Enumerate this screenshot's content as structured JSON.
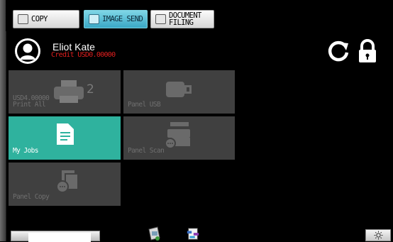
{
  "modes": {
    "copy_label": "COPY",
    "image_send_label": "IMAGE SEND",
    "document_filing_label": "DOCUMENT FILING"
  },
  "user": {
    "name": "Eliot Kate",
    "credit": "Credit USD0.00000"
  },
  "tiles": {
    "print_all": {
      "label": "Print All",
      "amount": "USD4.00000",
      "count": "2",
      "icon": "printer-icon"
    },
    "panel_usb": {
      "label": "Panel USB",
      "icon": "usb-icon"
    },
    "my_jobs": {
      "label": "My Jobs",
      "icon": "document-icon"
    },
    "panel_scan": {
      "label": "Panel Scan",
      "icon": "scanner-icon"
    },
    "panel_copy": {
      "label": "Panel Copy",
      "icon": "copy-icon"
    }
  },
  "colors": {
    "active_tile": "#2fb29e",
    "inactive_tile": "#404040",
    "credit_text": "#e01e1e",
    "active_mode": "#3aa8c6"
  }
}
